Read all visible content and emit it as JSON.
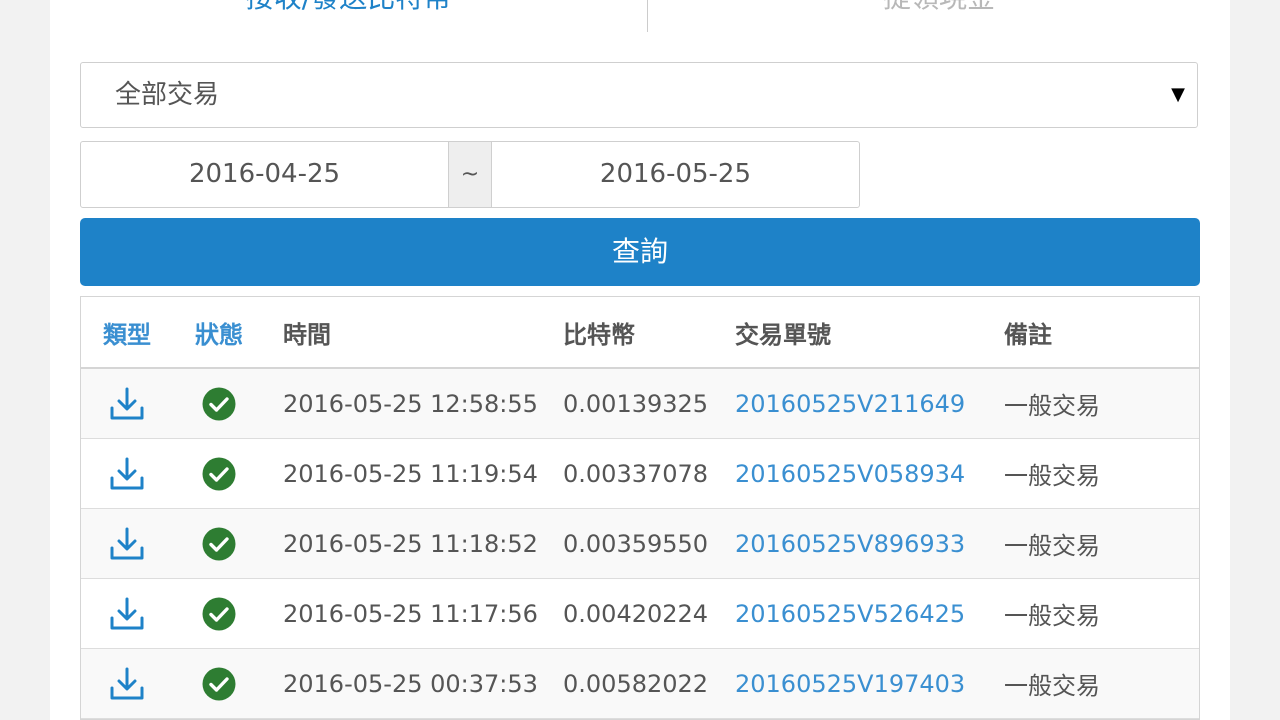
{
  "tabs": {
    "active_label": "接收/發送比特幣",
    "inactive_label": "提領現金"
  },
  "filter": {
    "selected": "全部交易",
    "arrow": "▼"
  },
  "date_range": {
    "start": "2016-04-25",
    "separator": "~",
    "end": "2016-05-25"
  },
  "query_button": "查詢",
  "table": {
    "headers": {
      "type": "類型",
      "status": "狀態",
      "time": "時間",
      "btc": "比特幣",
      "txid": "交易單號",
      "note": "備註"
    },
    "rows": [
      {
        "time": "2016-05-25 12:58:55",
        "btc": "0.00139325",
        "txid": "20160525V211649",
        "note": "一般交易"
      },
      {
        "time": "2016-05-25 11:19:54",
        "btc": "0.00337078",
        "txid": "20160525V058934",
        "note": "一般交易"
      },
      {
        "time": "2016-05-25 11:18:52",
        "btc": "0.00359550",
        "txid": "20160525V896933",
        "note": "一般交易"
      },
      {
        "time": "2016-05-25 11:17:56",
        "btc": "0.00420224",
        "txid": "20160525V526425",
        "note": "一般交易"
      },
      {
        "time": "2016-05-25 00:37:53",
        "btc": "0.00582022",
        "txid": "20160525V197403",
        "note": "一般交易"
      }
    ]
  },
  "icons": {
    "type": "download-icon",
    "status": "check-circle-icon"
  },
  "colors": {
    "accent": "#1e82c8",
    "link": "#3a8fd1",
    "success": "#2e7d32"
  }
}
